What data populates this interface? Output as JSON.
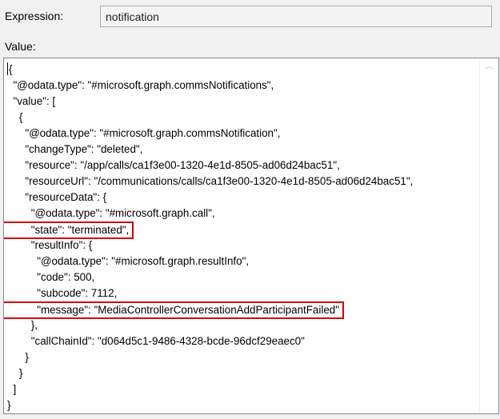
{
  "expression": {
    "label": "Expression:",
    "value": "notification"
  },
  "value": {
    "label": "Value:",
    "lines": [
      "{",
      "  \"@odata.type\": \"#microsoft.graph.commsNotifications\",",
      "  \"value\": [",
      "    {",
      "      \"@odata.type\": \"#microsoft.graph.commsNotification\",",
      "      \"changeType\": \"deleted\",",
      "      \"resource\": \"/app/calls/ca1f3e00-1320-4e1d-8505-ad06d24bac51\",",
      "      \"resourceUrl\": \"/communications/calls/ca1f3e00-1320-4e1d-8505-ad06d24bac51\",",
      "      \"resourceData\": {",
      "        \"@odata.type\": \"#microsoft.graph.call\",",
      "        \"state\": \"terminated\",",
      "        \"resultInfo\": {",
      "          \"@odata.type\": \"#microsoft.graph.resultInfo\",",
      "          \"code\": 500,",
      "          \"subcode\": 7112,",
      "          \"message\": \"MediaControllerConversationAddParticipantFailed\"",
      "        },",
      "        \"callChainId\": \"d064d5c1-9486-4328-bcde-96dcf29eaec0\"",
      "      }",
      "    }",
      "  ]",
      "}"
    ],
    "highlighted_lines": [
      10,
      15
    ]
  },
  "scrollbar": {
    "up_arrow": "︿"
  },
  "colors": {
    "highlight_border": "#d40000"
  }
}
